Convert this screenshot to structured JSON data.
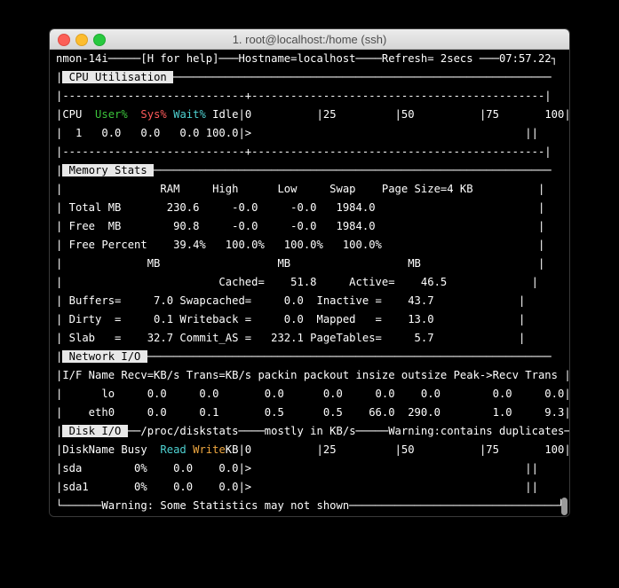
{
  "window": {
    "title": "1. root@localhost:/home (ssh)"
  },
  "top_bar": {
    "line": "nmon-14i─────[H for help]───Hostname=localhost────Refresh= 2secs ───07:57.22┐"
  },
  "cpu": {
    "header": " CPU Utilisation ",
    "header_rest": "──────────────────────────────────────────────────────────",
    "rule": "|----------------------------+---------------------------------------------|",
    "col_cpu": "|CPU  ",
    "col_user": "User%",
    "col_sys": "Sys%",
    "col_wait": "Wait%",
    "col_rest": " Idle|0          |25         |50          |75       100||",
    "row1": "|  1   0.0   0.0   0.0 100.0|>                                          ||",
    "rule2": "|----------------------------+---------------------------------------------|"
  },
  "memory": {
    "header": " Memory Stats ",
    "header_rest": "─────────────────────────────────────────────────────────────",
    "lines": [
      "|               RAM     High      Low     Swap    Page Size=4 KB          |",
      "| Total MB       230.6     -0.0     -0.0   1984.0                         |",
      "| Free  MB        90.8     -0.0     -0.0   1984.0                         |",
      "| Free Percent    39.4%   100.0%   100.0%   100.0%                        |",
      "|             MB                  MB                  MB                  |",
      "|                        Cached=    51.8     Active=    46.5             |",
      "| Buffers=     7.0 Swapcached=     0.0  Inactive =    43.7             |",
      "| Dirty  =     0.1 Writeback =     0.0  Mapped   =    13.0             |",
      "| Slab   =    32.7 Commit_AS =   232.1 PageTables=     5.7             |"
    ]
  },
  "network": {
    "header": " Network I/O ",
    "header_rest": "──────────────────────────────────────────────────────────────",
    "lines": [
      "|I/F Name Recv=KB/s Trans=KB/s packin packout insize outsize Peak->Recv Trans |",
      "|      lo     0.0     0.0       0.0      0.0     0.0    0.0        0.0     0.0|",
      "|    eth0     0.0     0.1       0.5      0.5    66.0  290.0        1.0     9.3|"
    ]
  },
  "disk": {
    "header": " Disk I/O ",
    "header_rest": "──/proc/diskstats────mostly in KB/s─────Warning:contains duplicates─|",
    "col_name": "|DiskName Busy  ",
    "col_read": "Read",
    "col_write": "Write",
    "col_rest": "KB|0          |25         |50          |75       100||",
    "rows": [
      "|sda        0%    0.0    0.0|>                                          ||",
      "|sda1       0%    0.0    0.0|>                                          ||"
    ]
  },
  "footer": {
    "line": "└──────Warning: Some Statistics may not shown────────────────────────────────┘"
  }
}
